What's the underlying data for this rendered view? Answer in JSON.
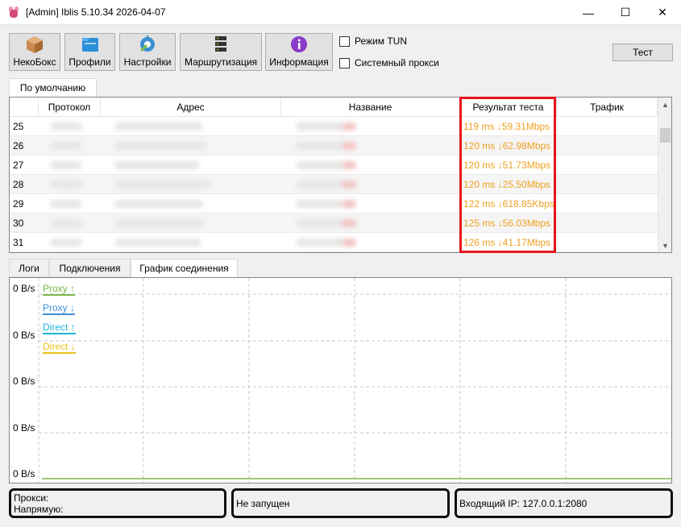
{
  "window": {
    "title": "[Admin] Iblis 5.10.34 2026-04-07",
    "minimize_glyph": "—",
    "maximize_glyph": "☐",
    "close_glyph": "✕"
  },
  "toolbar": {
    "buttons": [
      {
        "label": "НекоБокс",
        "icon": "box-icon"
      },
      {
        "label": "Профили",
        "icon": "profiles-icon"
      },
      {
        "label": "Настройки",
        "icon": "settings-icon"
      },
      {
        "label": "Маршрутизация",
        "icon": "routing-icon"
      },
      {
        "label": "Информация",
        "icon": "info-icon"
      }
    ],
    "tun_mode": "Режим TUN",
    "system_proxy": "Системный прокси",
    "test": "Тест"
  },
  "group_tab": "По умолчанию",
  "table": {
    "headers": [
      "Протокол",
      "Адрес",
      "Название",
      "Результат теста",
      "Трафик"
    ],
    "rows": [
      {
        "num": "25",
        "result": "119 ms ↓59.31Mbps"
      },
      {
        "num": "26",
        "result": "120 ms ↓62.98Mbps"
      },
      {
        "num": "27",
        "result": "120 ms ↓51.73Mbps"
      },
      {
        "num": "28",
        "result": "120 ms ↓25.50Mbps"
      },
      {
        "num": "29",
        "result": "122 ms ↓618.85Kbps"
      },
      {
        "num": "30",
        "result": "125 ms ↓56.03Mbps"
      },
      {
        "num": "31",
        "result": "126 ms ↓41.17Mbps"
      }
    ],
    "result_color": "#f0a020",
    "highlight_color": "#e8141b"
  },
  "bottom_tabs": [
    "Логи",
    "Подключения",
    "График соединения"
  ],
  "graph": {
    "y_labels": [
      "0 B/s",
      "0 B/s",
      "0 B/s",
      "0 B/s",
      "0 B/s"
    ],
    "legend": [
      {
        "label": "Proxy ↑",
        "color": "#7ab648"
      },
      {
        "label": "Proxy ↓",
        "color": "#3c8fd6"
      },
      {
        "label": "Direct ↑",
        "color": "#1fb4d8"
      },
      {
        "label": "Direct ↓",
        "color": "#e8c21a"
      }
    ]
  },
  "status": {
    "proxy": "Прокси:",
    "direct": "Напрямую:",
    "state": "Не запущен",
    "inbound": "Входящий IP: 127.0.0.1:2080"
  }
}
